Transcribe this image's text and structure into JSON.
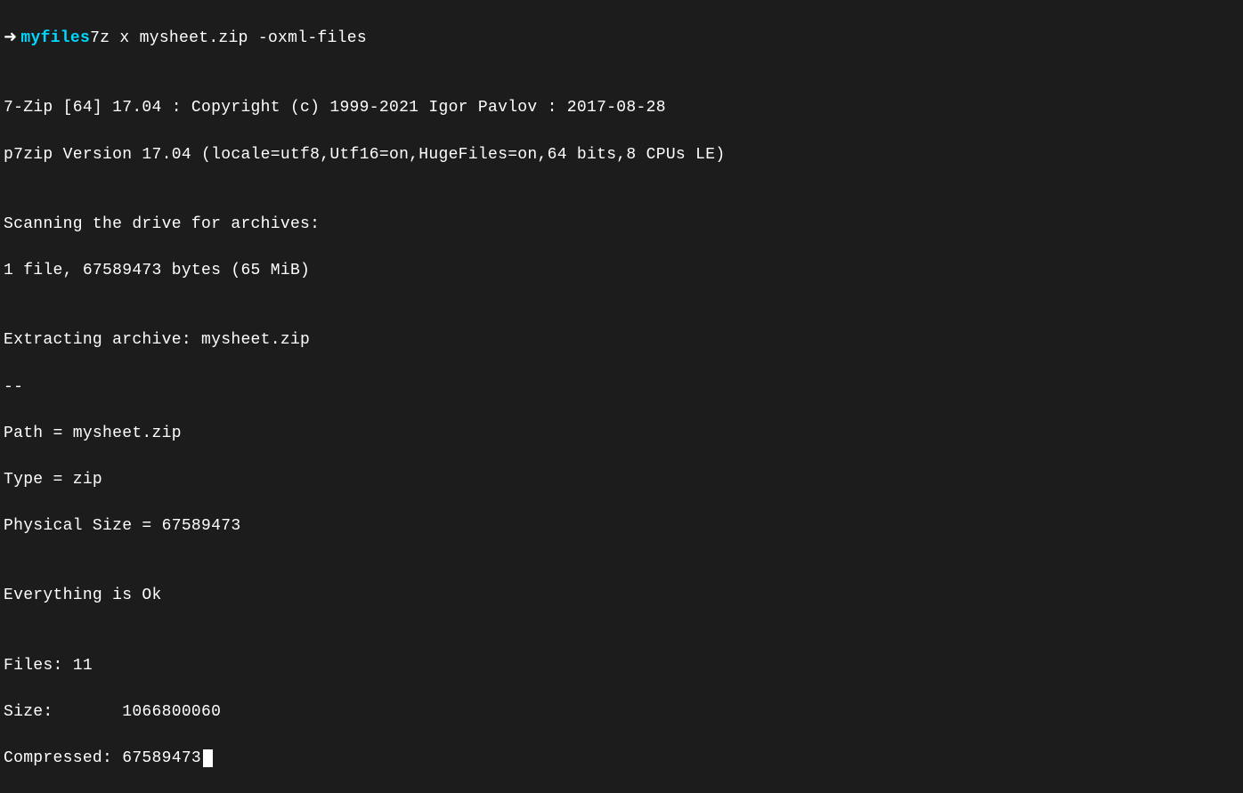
{
  "prompt": {
    "arrow": "➜",
    "dir": "myfiles",
    "command": "7z x mysheet.zip -oxml-files"
  },
  "output": {
    "line1": "",
    "line2": "7-Zip [64] 17.04 : Copyright (c) 1999-2021 Igor Pavlov : 2017-08-28",
    "line3": "p7zip Version 17.04 (locale=utf8,Utf16=on,HugeFiles=on,64 bits,8 CPUs LE)",
    "line4": "",
    "line5": "Scanning the drive for archives:",
    "line6": "1 file, 67589473 bytes (65 MiB)",
    "line7": "",
    "line8": "Extracting archive: mysheet.zip",
    "line9": "--",
    "line10": "Path = mysheet.zip",
    "line11": "Type = zip",
    "line12": "Physical Size = 67589473",
    "line13": "",
    "line14": "Everything is Ok",
    "line15": "",
    "line16": "Files: 11",
    "line17": "Size:       1066800060",
    "line18": "Compressed: 67589473"
  }
}
